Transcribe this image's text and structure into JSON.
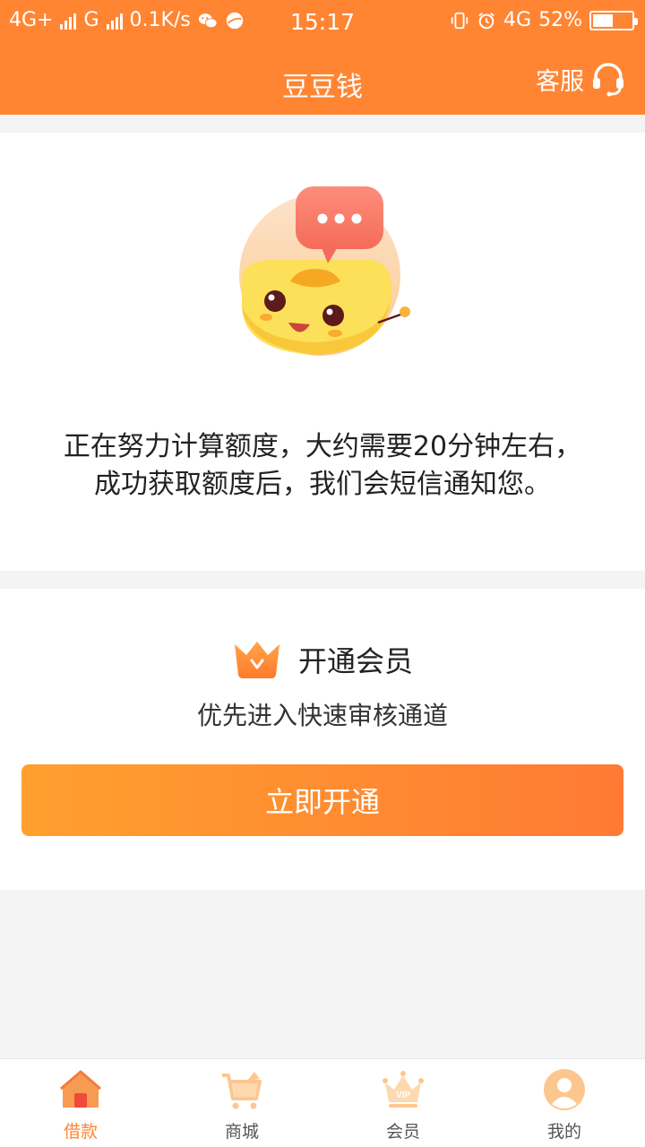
{
  "status_bar": {
    "network1": "4G+",
    "network2": "G",
    "speed": "0.1K/s",
    "time": "15:17",
    "network3": "4G",
    "battery_text": "52%",
    "battery_level": 0.52
  },
  "header": {
    "title": "豆豆钱",
    "service_label": "客服"
  },
  "calc_card": {
    "line1": "正在努力计算额度，大约需要20分钟左右，",
    "line2": "成功获取额度后，我们会短信通知您。"
  },
  "member_card": {
    "title": "开通会员",
    "subtitle": "优先进入快速审核通道",
    "button_label": "立即开通"
  },
  "tabbar": {
    "items": [
      {
        "label": "借款",
        "icon": "house-icon",
        "active": true
      },
      {
        "label": "商城",
        "icon": "cart-icon",
        "active": false
      },
      {
        "label": "会员",
        "icon": "vip-crown-icon",
        "active": false
      },
      {
        "label": "我的",
        "icon": "user-avatar-icon",
        "active": false
      }
    ]
  },
  "colors": {
    "brand": "#ff8533",
    "button_start": "#ffa02e",
    "button_end": "#ff7a34",
    "background": "#f4f4f4"
  }
}
